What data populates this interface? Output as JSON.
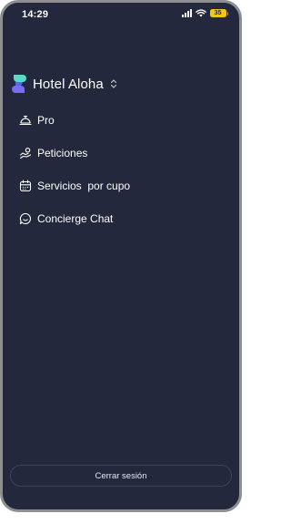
{
  "status_bar": {
    "time": "14:29",
    "battery_level": "35"
  },
  "brand": {
    "name": "Hotel Aloha",
    "logo_colors": {
      "top": "#5fd6c8",
      "bottom": "#7b6cf6"
    }
  },
  "nav": {
    "items": [
      {
        "label": "Pro",
        "icon": "concierge-bell-icon"
      },
      {
        "label": "Peticiones",
        "icon": "handshake-icon"
      },
      {
        "label": "Servicios  por cupo",
        "icon": "calendar-icon"
      },
      {
        "label": "Concierge Chat",
        "icon": "chat-bubble-icon"
      }
    ]
  },
  "footer": {
    "logout_label": "Cerrar sesión"
  },
  "colors": {
    "background": "#24283d",
    "text": "#ffffff",
    "battery": "#f5c518"
  }
}
